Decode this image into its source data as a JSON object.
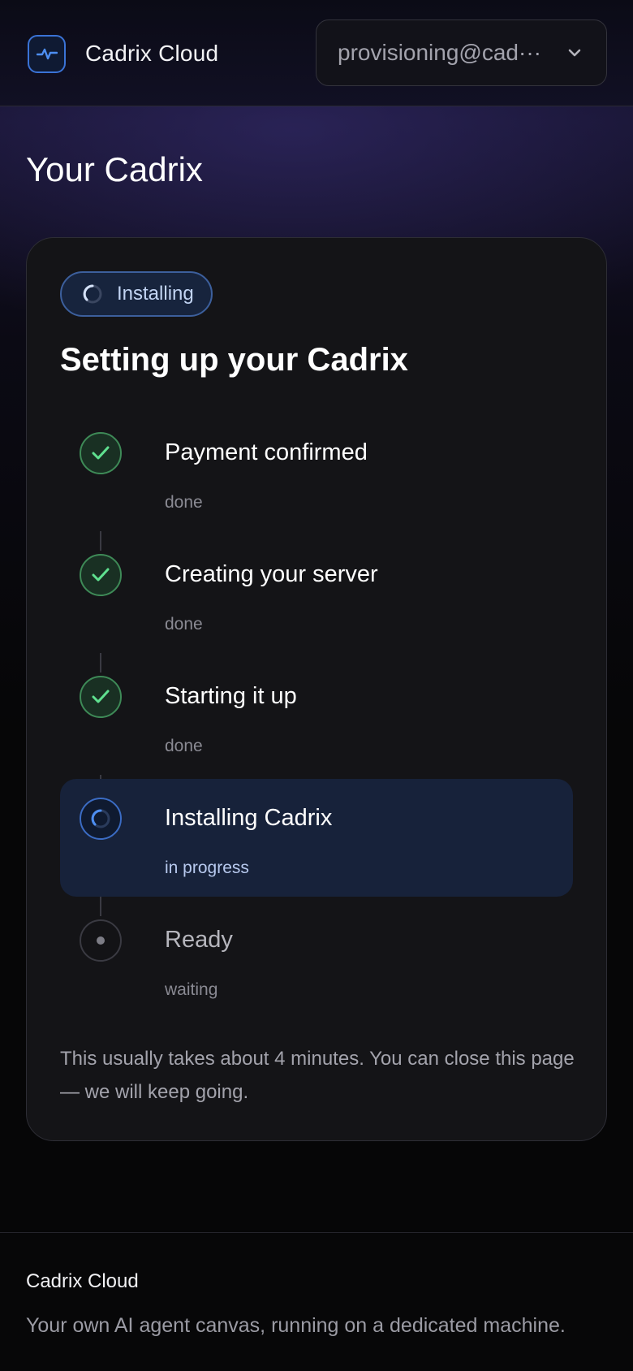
{
  "header": {
    "brand_name": "Cadrix Cloud",
    "account_email": "provisioning@cad···",
    "brand_icon": "pulse-icon",
    "dropdown_icon": "chevron-down-icon"
  },
  "main": {
    "page_title": "Your Cadrix"
  },
  "card": {
    "status_pill": "Installing",
    "title": "Setting up your Cadrix",
    "steps": [
      {
        "label": "Payment confirmed",
        "status": "done",
        "state": "done"
      },
      {
        "label": "Creating your server",
        "status": "done",
        "state": "done"
      },
      {
        "label": "Starting it up",
        "status": "done",
        "state": "done"
      },
      {
        "label": "Installing Cadrix",
        "status": "in progress",
        "state": "in-progress"
      },
      {
        "label": "Ready",
        "status": "waiting",
        "state": "waiting"
      }
    ],
    "note": "This usually takes about 4 minutes. You can close this page — we will keep going."
  },
  "footer": {
    "title": "Cadrix Cloud",
    "tagline": "Your own AI agent canvas, running on a dedicated machine."
  },
  "colors": {
    "accent_blue": "#3b6cc4",
    "done_green": "#4ade80",
    "card_bg": "#141417"
  }
}
